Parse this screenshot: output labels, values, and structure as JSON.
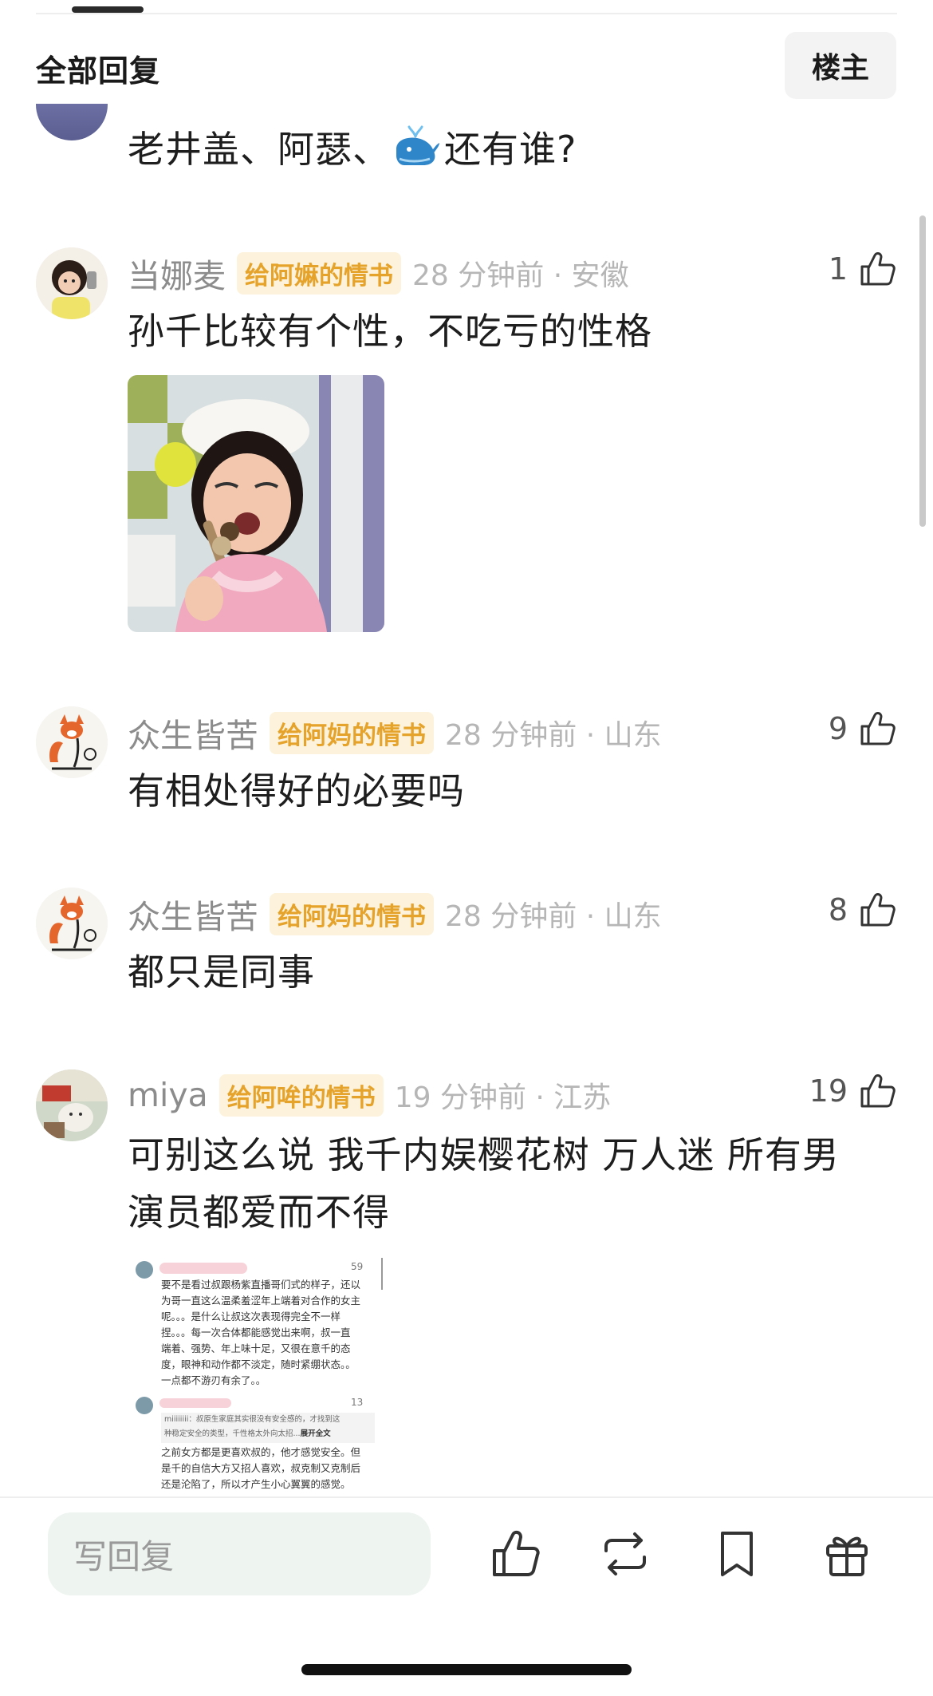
{
  "header": {
    "title": "全部回复",
    "owner_label": "楼主"
  },
  "top_comment": {
    "text_a": "老井盖、阿瑟、",
    "text_b": "还有谁?"
  },
  "comments": [
    {
      "username": "当娜麦",
      "badge": "给阿嫲的情书",
      "time": "28 分钟前 · 安徽",
      "likes": "1",
      "text": "孙千比较有个性，不吃亏的性格"
    },
    {
      "username": "众生皆苦",
      "badge": "给阿妈的情书",
      "time": "28 分钟前 · 山东",
      "likes": "9",
      "text": "有相处得好的必要吗"
    },
    {
      "username": "众生皆苦",
      "badge": "给阿妈的情书",
      "time": "28 分钟前 · 山东",
      "likes": "8",
      "text": "都只是同事"
    },
    {
      "username": "miya",
      "badge": "给阿哞的情书",
      "time": "19 分钟前 · 江苏",
      "likes": "19",
      "text_line1": "可别这么说 我千内娱樱花树 万人迷 所有男",
      "text_line2": "演员都爱而不得"
    }
  ],
  "screenshot": {
    "c1_likes": "59",
    "c1_lines": [
      "要不是看过叔跟杨紫直播哥们式的样子，还以",
      "为哥一直这么温柔羞涩年上端着对合作的女主",
      "呢。。。是什么让叔这次表现得完全不一样",
      "捏。。。每一次合体都能感觉出来啊，叔一直",
      "端着、强势、年上味十足，又很在意千的态",
      "度，眼神和动作都不淡定，随时紧绷状态。。",
      "一点都不游刃有余了。。"
    ],
    "c2_likes": "13",
    "c2_quote_line1": "miiiiiiii：叔原生家庭其实很没有安全感的，才找到这",
    "c2_quote_line2": "种稳定安全的类型，千性格太外向太招...",
    "c2_expand": "展开全文",
    "c2_lines": [
      "之前女方都是更喜欢叔的，他才感觉安全。但",
      "是千的自信大方又招人喜欢，叔克制又克制后",
      "还是沦陷了，所以才产生小心翼翼的感觉。"
    ]
  },
  "bottom_bar": {
    "reply_placeholder": "写回复"
  }
}
